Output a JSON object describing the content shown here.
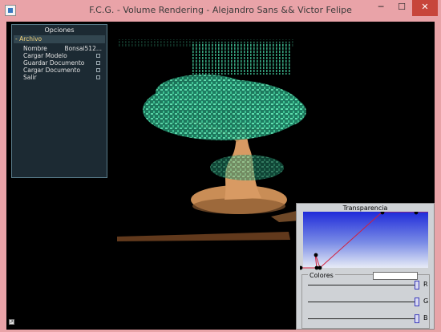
{
  "window": {
    "title": "F.C.G. - Volume Rendering - Alejandro Sans && Victor Felipe",
    "minimize": "─",
    "maximize": "☐",
    "close": "✕"
  },
  "opciones": {
    "title": "Opciones",
    "menu": "Archivo",
    "items": [
      {
        "label": "Nombre",
        "value": "Bonsai512..."
      },
      {
        "label": "Cargar Modelo"
      },
      {
        "label": "Guardar Documento"
      },
      {
        "label": "Cargar Documento"
      },
      {
        "label": "Salir"
      }
    ]
  },
  "transfer": {
    "title": "Transparencia",
    "colors_title": "Colores",
    "sliders": [
      {
        "label": "R",
        "value": 1.0
      },
      {
        "label": "G",
        "value": 1.0
      },
      {
        "label": "B",
        "value": 1.0
      }
    ],
    "swatch_color": "#ffffff"
  },
  "scene": {
    "subject": "bonsai-volume",
    "foliage_color": "#4fd6a8",
    "trunk_color": "#d89a63",
    "background": "#000000"
  }
}
